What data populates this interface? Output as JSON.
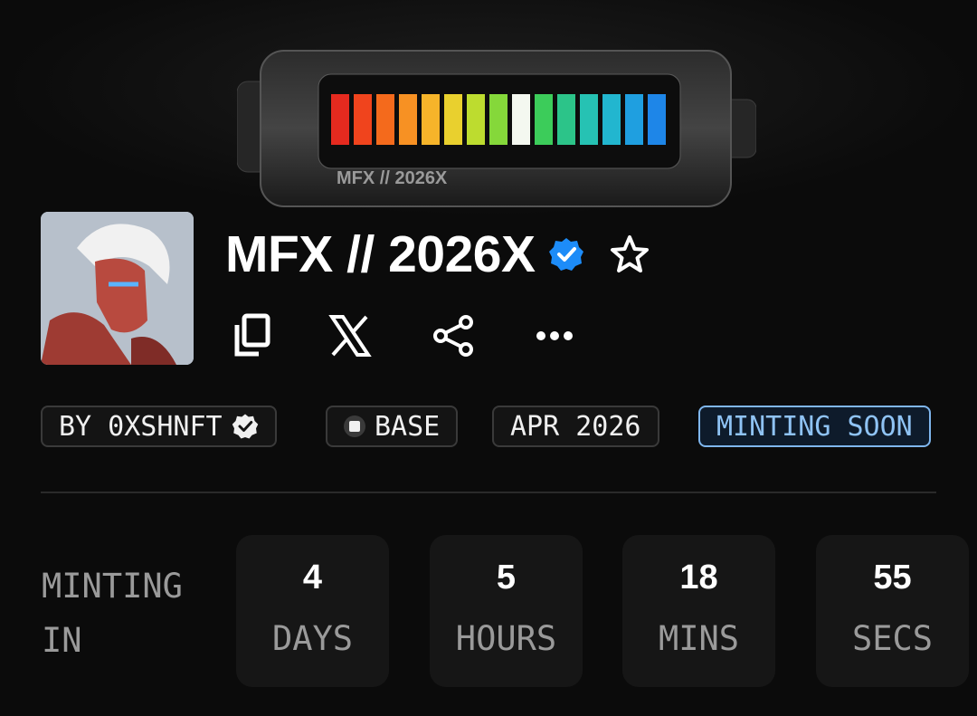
{
  "collection": {
    "title": "MFX // 2026X",
    "verified": true,
    "banner_text": "MFX // 2026X"
  },
  "actions": [
    {
      "name": "copy-icon"
    },
    {
      "name": "x-logo-icon"
    },
    {
      "name": "share-icon"
    },
    {
      "name": "more-icon"
    }
  ],
  "tags": {
    "creator": "BY 0XSHNFT",
    "chain": "BASE",
    "date": "APR 2026",
    "status": "MINTING SOON"
  },
  "countdown": {
    "label_line1": "MINTING",
    "label_line2": "IN",
    "days_value": "4",
    "days_unit": "DAYS",
    "hours_value": "5",
    "hours_unit": "HOURS",
    "mins_value": "18",
    "mins_unit": "MINS",
    "secs_value": "55",
    "secs_unit": "SECS"
  },
  "colors": {
    "background": "#0b0b0b",
    "verified_blue": "#1d8cf8",
    "status_blue": "#8fc3f4"
  }
}
